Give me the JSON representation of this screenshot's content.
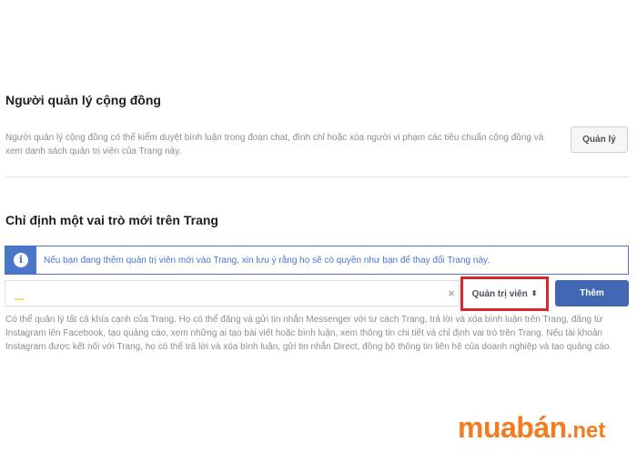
{
  "community_manager": {
    "title": "Người quản lý cộng đồng",
    "description": "Người quản lý cộng đồng có thể kiểm duyệt bình luận trong đoạn chat, đình chỉ hoặc xóa người vi phạm các tiêu chuẩn cộng đồng và xem danh sách quản trị viên của Trang này.",
    "button_label": "Quản lý"
  },
  "assign_role": {
    "title": "Chỉ định một vai trò mới trên Trang",
    "notice": "Nếu bạn đang thêm quản trị viên mới vào Trang, xin lưu ý rằng họ sẽ có quyền như bạn để thay đổi Trang này.",
    "name_input_value": "",
    "clear_symbol": "×",
    "role_selected": "Quản trị viên",
    "add_button_label": "Thêm",
    "role_description": "Có thể quản lý tất cả khía cạnh của Trang. Họ có thể đăng và gửi tin nhắn Messenger với tư cách Trang, trả lời và xóa bình luận trên Trang, đăng từ Instagram lên Facebook, tạo quảng cáo, xem những ai tạo bài viết hoặc bình luận, xem thông tin chi tiết và chỉ định vai trò trên Trang. Nếu tài khoản Instagram được kết nối với Trang, họ có thể trả lời và xóa bình luận, gửi tin nhắn Direct, đồng bộ thông tin liên hệ của doanh nghiệp và tạo quảng cáo."
  },
  "watermark": {
    "main": "muabán",
    "tld": ".net"
  },
  "colors": {
    "accent": "#4267b2",
    "highlight_border": "#d7262e",
    "watermark": "#f47b20"
  }
}
